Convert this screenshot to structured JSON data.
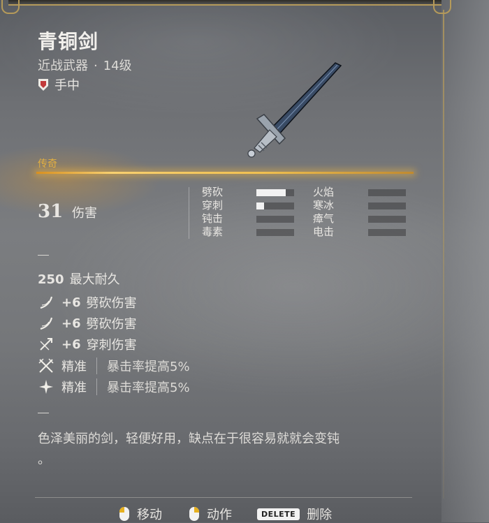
{
  "item": {
    "name": "青铜剑",
    "category": "近战武器",
    "separator": "·",
    "level": "14级",
    "slot": "手中",
    "rarity": "传奇",
    "rarity_color": "#e4b040"
  },
  "damage": {
    "value": "31",
    "label": "伤害"
  },
  "damage_types": {
    "left": [
      {
        "label": "劈砍",
        "fill": 0.78
      },
      {
        "label": "穿刺",
        "fill": 0.2
      },
      {
        "label": "钝击",
        "fill": 0.0
      },
      {
        "label": "毒素",
        "fill": 0.0
      }
    ],
    "right": [
      {
        "label": "火焰",
        "fill": 0.0
      },
      {
        "label": "寒冰",
        "fill": 0.0
      },
      {
        "label": "瘴气",
        "fill": 0.0
      },
      {
        "label": "电击",
        "fill": 0.0
      }
    ]
  },
  "divider": "—",
  "durability": {
    "value": "250",
    "label": "最大耐久"
  },
  "bonuses": [
    {
      "icon": "slash-icon",
      "value": "+6",
      "label": "劈砍伤害"
    },
    {
      "icon": "slash-icon",
      "value": "+6",
      "label": "劈砍伤害"
    },
    {
      "icon": "pierce-icon",
      "value": "+6",
      "label": "穿刺伤害"
    }
  ],
  "traits": [
    {
      "icon": "crossed-swords-icon",
      "name": "精准",
      "effect": "暴击率提高5%"
    },
    {
      "icon": "sparkle-icon",
      "name": "精准",
      "effect": "暴击率提高5%"
    }
  ],
  "description": "色泽美丽的剑，轻便好用，缺点在于很容易就就会变钝\n。",
  "footer": {
    "move": "移动",
    "action": "动作",
    "delete_key": "DELETE",
    "delete": "删除"
  }
}
